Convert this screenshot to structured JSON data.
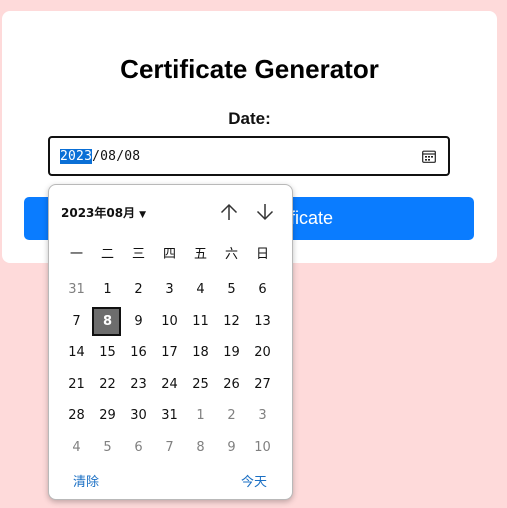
{
  "page": {
    "title": "Certificate Generator",
    "date_label": "Date:",
    "date_input": {
      "year": "2023",
      "rest": "/08/08"
    },
    "generate_button_partial": "ficate"
  },
  "picker": {
    "month_label": "2023年08月",
    "weekdays": [
      "一",
      "二",
      "三",
      "四",
      "五",
      "六",
      "日"
    ],
    "weeks": [
      [
        "31",
        "1",
        "2",
        "3",
        "4",
        "5",
        "6"
      ],
      [
        "7",
        "8",
        "9",
        "10",
        "11",
        "12",
        "13"
      ],
      [
        "14",
        "15",
        "16",
        "17",
        "18",
        "19",
        "20"
      ],
      [
        "21",
        "22",
        "23",
        "24",
        "25",
        "26",
        "27"
      ],
      [
        "28",
        "29",
        "30",
        "31",
        "1",
        "2",
        "3"
      ],
      [
        "4",
        "5",
        "6",
        "7",
        "8",
        "9",
        "10"
      ]
    ],
    "selected_day": "8",
    "clear_label": "清除",
    "today_label": "今天"
  },
  "colors": {
    "background": "#fedada",
    "accent": "#0a7cff",
    "link": "#1a6fc4",
    "selection": "#0a6fd6"
  }
}
